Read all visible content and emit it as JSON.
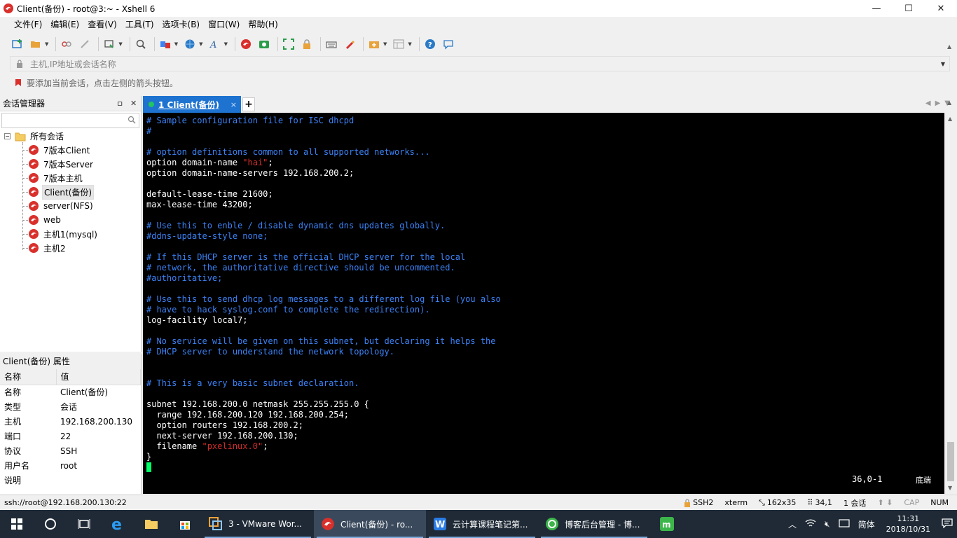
{
  "window": {
    "title": "Client(备份)   - root@3:~ - Xshell 6",
    "controls": {
      "minimize": "—",
      "maximize": "☐",
      "close": "✕"
    }
  },
  "menu": [
    "文件(F)",
    "编辑(E)",
    "查看(V)",
    "工具(T)",
    "选项卡(B)",
    "窗口(W)",
    "帮助(H)"
  ],
  "address": {
    "placeholder": "主机,IP地址或会话名称"
  },
  "hint": "要添加当前会话，点击左侧的箭头按钮。",
  "session_manager": {
    "title": "会话管理器",
    "pin": "ㅁ",
    "close": "✕",
    "root": "所有会话",
    "sessions": [
      "7版本Client",
      "7版本Server",
      "7版本主机",
      "Client(备份)",
      "server(NFS)",
      "web",
      "主机1(mysql)",
      "主机2"
    ],
    "selected_index": 3
  },
  "properties": {
    "title": "Client(备份) 属性",
    "header": [
      "名称",
      "值"
    ],
    "rows": [
      [
        "名称",
        "Client(备份)"
      ],
      [
        "类型",
        "会话"
      ],
      [
        "主机",
        "192.168.200.130"
      ],
      [
        "端口",
        "22"
      ],
      [
        "协议",
        "SSH"
      ],
      [
        "用户名",
        "root"
      ],
      [
        "说明",
        ""
      ]
    ]
  },
  "tab": {
    "label": "1 Client(备份)",
    "close": "×",
    "add": "+"
  },
  "terminal": {
    "lines": [
      [
        {
          "t": "# Sample configuration file for ISC dhcpd",
          "c": "comment"
        }
      ],
      [
        {
          "t": "#",
          "c": "comment"
        }
      ],
      [],
      [
        {
          "t": "# option definitions common to all supported networks...",
          "c": "comment"
        }
      ],
      [
        {
          "t": "option domain-name ",
          "c": ""
        },
        {
          "t": "\"hai\"",
          "c": "str"
        },
        {
          "t": ";",
          "c": ""
        }
      ],
      [
        {
          "t": "option domain-name-servers 192.168.200.2;",
          "c": ""
        }
      ],
      [],
      [
        {
          "t": "default-lease-time 21600;",
          "c": ""
        }
      ],
      [
        {
          "t": "max-lease-time 43200;",
          "c": ""
        }
      ],
      [],
      [
        {
          "t": "# Use this to enble / disable dynamic dns updates globally.",
          "c": "comment"
        }
      ],
      [
        {
          "t": "#ddns-update-style none;",
          "c": "comment"
        }
      ],
      [],
      [
        {
          "t": "# If this DHCP server is the official DHCP server for the local",
          "c": "comment"
        }
      ],
      [
        {
          "t": "# network, the authoritative directive should be uncommented.",
          "c": "comment"
        }
      ],
      [
        {
          "t": "#authoritative;",
          "c": "comment"
        }
      ],
      [],
      [
        {
          "t": "# Use this to send dhcp log messages to a different log file (you also",
          "c": "comment"
        }
      ],
      [
        {
          "t": "# have to hack syslog.conf to complete the redirection).",
          "c": "comment"
        }
      ],
      [
        {
          "t": "log-facility local7;",
          "c": ""
        }
      ],
      [],
      [
        {
          "t": "# No service will be given on this subnet, but declaring it helps the",
          "c": "comment"
        }
      ],
      [
        {
          "t": "# DHCP server to understand the network topology.",
          "c": "comment"
        }
      ],
      [],
      [],
      [
        {
          "t": "# This is a very basic subnet declaration.",
          "c": "comment"
        }
      ],
      [],
      [
        {
          "t": "subnet 192.168.200.0 netmask 255.255.255.0 {",
          "c": ""
        }
      ],
      [
        {
          "t": "  range 192.168.200.120 192.168.200.254;",
          "c": ""
        }
      ],
      [
        {
          "t": "  option routers 192.168.200.2;",
          "c": ""
        }
      ],
      [
        {
          "t": "  next-server 192.168.200.130;",
          "c": ""
        }
      ],
      [
        {
          "t": "  filename ",
          "c": ""
        },
        {
          "t": "\"pxelinux.0\"",
          "c": "str"
        },
        {
          "t": ";",
          "c": ""
        }
      ],
      [
        {
          "t": "}",
          "c": ""
        }
      ]
    ],
    "position": "36,0-1",
    "mode": "底端"
  },
  "status": {
    "connection": "ssh://root@192.168.200.130:22",
    "protocol": "SSH2",
    "term": "xterm",
    "size": "162x35",
    "cursor": "34,1",
    "sessions": "1 会话",
    "cap": "CAP",
    "num": "NUM"
  },
  "taskbar": {
    "apps": [
      {
        "label": "3 - VMware Wor...",
        "state": "running"
      },
      {
        "label": "Client(备份)  - ro...",
        "state": "active"
      },
      {
        "label": "云计算课程笔记第...",
        "state": "running"
      },
      {
        "label": "博客后台管理 - 博...",
        "state": "running"
      }
    ],
    "ime": "简体",
    "time": "11:31",
    "date": "2018/10/31"
  },
  "colors": {
    "tab_active": "#1e73d0",
    "comment": "#3b82f6",
    "string": "#d42b2b",
    "cursor": "#00ff66",
    "taskbar": "#1f2a36"
  }
}
